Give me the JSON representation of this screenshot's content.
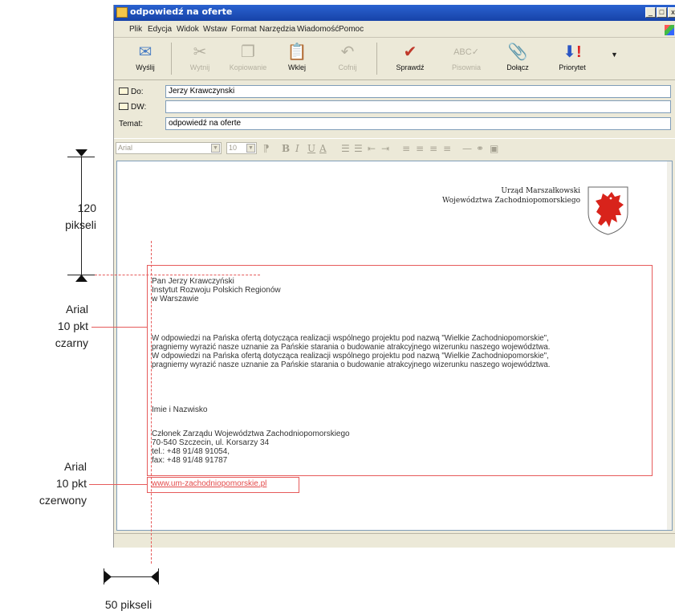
{
  "window": {
    "title": "odpowiedź na oferte",
    "controls": [
      "_",
      "□",
      "x"
    ]
  },
  "menu": [
    "Plik",
    "Edycja",
    "Widok",
    "Wstaw",
    "Format",
    "Narzędzia",
    "Wiadomość",
    "Pomoc"
  ],
  "toolbar": {
    "send": "Wyślij",
    "cut": "Wytnij",
    "copy": "Kopiowanie",
    "paste": "Wklej",
    "undo": "Cofnij",
    "check": "Sprawdź",
    "spelling": "Pisownia",
    "attach": "Dołącz",
    "priority": "Priorytet"
  },
  "header": {
    "to_label": "Do:",
    "to_value": "Jerzy Krawczynski",
    "cc_label": "DW:",
    "cc_value": "",
    "subject_label": "Temat:",
    "subject_value": "odpowiedź na oferte"
  },
  "format": {
    "font": "Arial",
    "size": "10"
  },
  "letterhead": {
    "line1": "Urząd Marszałkowski",
    "line2": "Województwa Zachodniopomorskiego"
  },
  "letter": {
    "recipient": [
      "Pan Jerzy Krawczyński",
      "Instytut Rozwoju Polskich Regionów",
      "w Warszawie"
    ],
    "body": [
      "W odpowiedzi na Pańska ofertą dotycząca realizacji wspólnego projektu pod nazwą \"Wielkie Zachodniopomorskie\",",
      "pragniemy wyrazić nasze uznanie za Pańskie starania o budowanie atrakcyjnego wizerunku naszego województwa.",
      "W odpowiedzi na Pańska ofertą dotycząca realizacji wspólnego projektu pod nazwą \"Wielkie Zachodniopomorskie\",",
      "pragniemy wyrazić nasze uznanie za Pańskie starania o budowanie atrakcyjnego wizerunku naszego województwa."
    ],
    "name": "Imie i Nazwisko",
    "signature": [
      "Członek Zarządu Województwa Zachodniopomorskiego",
      "70-540 Szczecin, ul. Korsarzy 34",
      "tel.: +48 91/48 91054,",
      "fax: +48 91/48 91787"
    ],
    "website": "www.um-zachodniopomorskie.pl"
  },
  "annotations": {
    "top_value": "120",
    "top_unit": "pikseli",
    "font1": [
      "Arial",
      "10 pkt",
      "czarny"
    ],
    "font2": [
      "Arial",
      "10 pkt",
      "czerwony"
    ],
    "left_margin": "50 pikseli"
  },
  "colors": {
    "annotation_red": "#e65b5b",
    "link_red": "#e34a4a",
    "title_blue": "#1e52c0"
  }
}
